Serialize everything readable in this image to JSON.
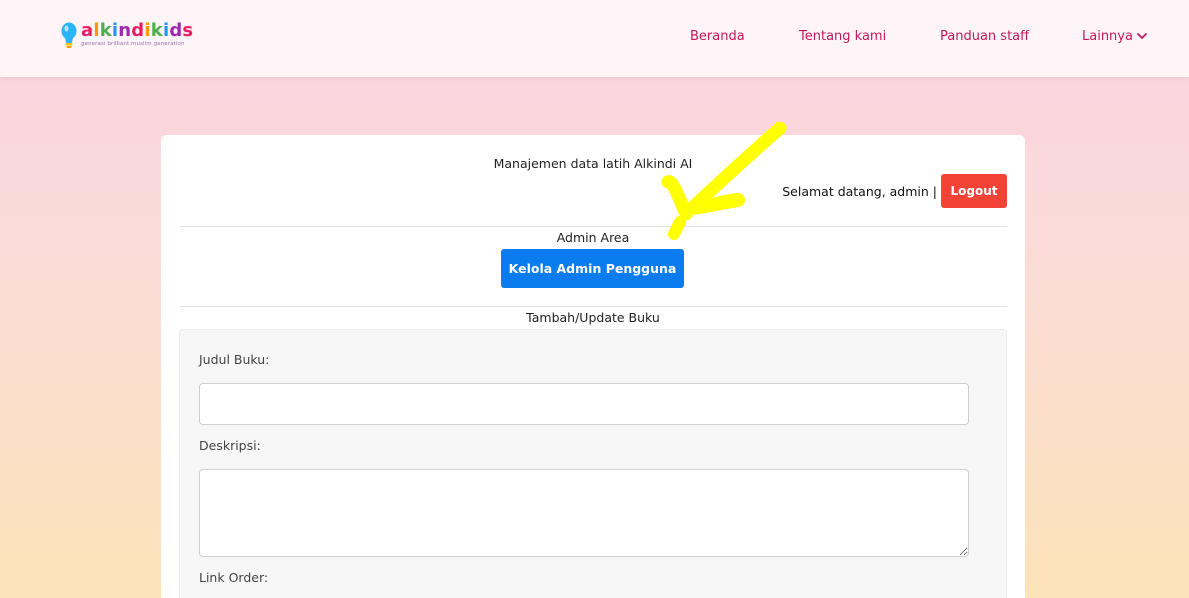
{
  "brand": {
    "name_letters": [
      "a",
      "l",
      "k",
      "i",
      "n",
      "d",
      "i",
      "k",
      "i",
      "d",
      "s"
    ],
    "name_colors": [
      "#e91e63",
      "#ff9800",
      "#4caf50",
      "#2196f3",
      "#9c27b0",
      "#e91e63",
      "#ff9800",
      "#4caf50",
      "#2196f3",
      "#9c27b0",
      "#e91e63"
    ],
    "tagline": "generasi brilliant muslim generation",
    "bulb_color": "#29b6f6",
    "bulb_base_color": "#ffc107"
  },
  "nav": {
    "items": [
      {
        "label": "Beranda"
      },
      {
        "label": "Tentang kami"
      },
      {
        "label": "Panduan staff"
      },
      {
        "label": "Lainnya"
      }
    ],
    "link_color": "#c2185b"
  },
  "header": {
    "title": "Manajemen data latih Alkindi AI",
    "welcome": "Selamat datang, admin |",
    "logout_label": "Logout"
  },
  "admin": {
    "section_label": "Admin Area",
    "manage_button_label": "Kelola Admin Pengguna"
  },
  "form": {
    "section_label": "Tambah/Update Buku",
    "title_label": "Judul Buku:",
    "title_value": "",
    "description_label": "Deskripsi:",
    "description_value": "",
    "order_link_label": "Link Order:"
  },
  "annotation": {
    "arrow_color": "#ffff00"
  }
}
